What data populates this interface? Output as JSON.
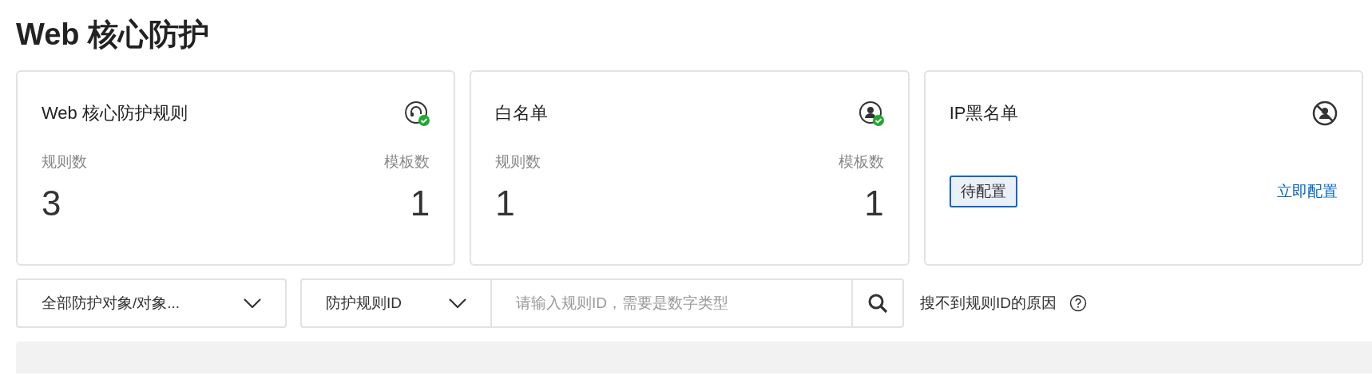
{
  "page_title": "Web 核心防护",
  "cards": [
    {
      "kind": "stats",
      "title": "Web 核心防护规则",
      "configured": true,
      "left_label": "规则数",
      "left_value": "3",
      "right_label": "模板数",
      "right_value": "1"
    },
    {
      "kind": "stats",
      "title": "白名单",
      "configured": true,
      "left_label": "规则数",
      "left_value": "1",
      "right_label": "模板数",
      "right_value": "1"
    },
    {
      "kind": "pending",
      "title": "IP黑名单",
      "configured": false,
      "status_tag": "待配置",
      "action_link": "立即配置"
    }
  ],
  "filters": {
    "scope_dropdown": "全部防护对象/对象...",
    "field_dropdown": "防护规则ID",
    "search": {
      "placeholder": "请输入规则ID，需要是数字类型"
    },
    "help_text": "搜不到规则ID的原因"
  }
}
